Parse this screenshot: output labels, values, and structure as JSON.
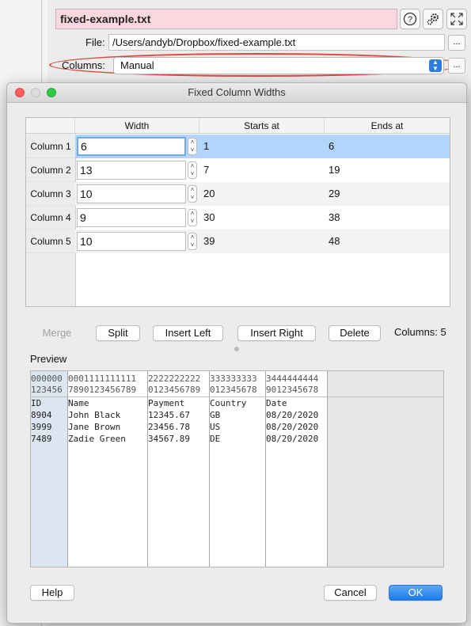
{
  "main_window": {
    "filename": "fixed-example.txt",
    "file_label": "File:",
    "file_path": "/Users/andyb/Dropbox/fixed-example.txt",
    "browse_label": "...",
    "columns_label": "Columns:",
    "columns_value": "Manual",
    "columns_more_label": "..."
  },
  "dialog": {
    "title": "Fixed Column Widths",
    "table": {
      "headers": [
        "Width",
        "Starts at",
        "Ends at"
      ],
      "rows": [
        {
          "label": "Column 1",
          "width": "6",
          "start": "1",
          "end": "6"
        },
        {
          "label": "Column 2",
          "width": "13",
          "start": "7",
          "end": "19"
        },
        {
          "label": "Column 3",
          "width": "10",
          "start": "20",
          "end": "29"
        },
        {
          "label": "Column 4",
          "width": "9",
          "start": "30",
          "end": "38"
        },
        {
          "label": "Column 5",
          "width": "10",
          "start": "39",
          "end": "48"
        }
      ],
      "selected_row": 0
    },
    "buttons": {
      "merge": "Merge",
      "split": "Split",
      "insert_left": "Insert Left",
      "insert_right": "Insert Right",
      "delete": "Delete"
    },
    "columns_count": "Columns: 5",
    "preview_label": "Preview",
    "preview": {
      "ruler_top": [
        "000000",
        "0001111111111",
        "2222222222",
        "333333333",
        "3444444444"
      ],
      "ruler_bottom": [
        "123456",
        "7890123456789",
        "0123456789",
        "012345678",
        "9012345678"
      ],
      "rows": [
        [
          "ID",
          "Name",
          "Payment",
          "Country",
          "Date"
        ],
        [
          "8904",
          "John Black",
          "12345.67",
          "GB",
          "08/20/2020"
        ],
        [
          "3999",
          "Jane Brown",
          "23456.78",
          "US",
          "08/20/2020"
        ],
        [
          "7489",
          "Zadie Green",
          "34567.89",
          "DE",
          "08/20/2020"
        ]
      ]
    },
    "help_label": "Help",
    "cancel_label": "Cancel",
    "ok_label": "OK"
  },
  "colors": {
    "filename_bg": "#fbd7e0",
    "highlight_oval": "#e0473c",
    "selection": "#b3d5fb",
    "primary_button": "#1b7af1",
    "preview_first_column": "#dbe6f1"
  },
  "icons": [
    "help-icon",
    "gear-icon",
    "expand-icon",
    "stepper-icon",
    "select-arrows-icon"
  ]
}
